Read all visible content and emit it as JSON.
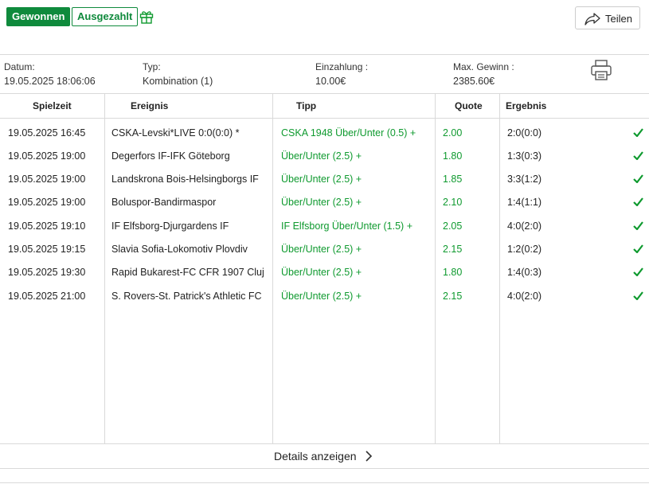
{
  "header": {
    "status_won": "Gewonnen",
    "status_paid": "Ausgezahlt",
    "share_label": "Teilen"
  },
  "info": {
    "date_label": "Datum:",
    "date_value": "19.05.2025 18:06:06",
    "type_label": "Typ:",
    "type_value": "Kombination (1)",
    "stake_label": "Einzahlung :",
    "stake_value": "10.00€",
    "maxwin_label": "Max. Gewinn :",
    "maxwin_value": "2385.60€"
  },
  "table": {
    "headers": {
      "time": "Spielzeit",
      "event": "Ereignis",
      "tip": "Tipp",
      "odds": "Quote",
      "result": "Ergebnis"
    },
    "rows": [
      {
        "time": "19.05.2025 16:45",
        "event": "CSKA-Levski*LIVE 0:0(0:0) *",
        "tip": "CSKA 1948 Über/Unter (0.5) +",
        "odds": "2.00",
        "result": "2:0(0:0)"
      },
      {
        "time": "19.05.2025 19:00",
        "event": "Degerfors IF-IFK Göteborg",
        "tip": "Über/Unter (2.5) +",
        "odds": "1.80",
        "result": "1:3(0:3)"
      },
      {
        "time": "19.05.2025 19:00",
        "event": "Landskrona Bois-Helsingborgs IF",
        "tip": "Über/Unter (2.5) +",
        "odds": "1.85",
        "result": "3:3(1:2)"
      },
      {
        "time": "19.05.2025 19:00",
        "event": "Boluspor-Bandirmaspor",
        "tip": "Über/Unter (2.5) +",
        "odds": "2.10",
        "result": "1:4(1:1)"
      },
      {
        "time": "19.05.2025 19:10",
        "event": "IF Elfsborg-Djurgardens IF",
        "tip": "IF Elfsborg Über/Unter (1.5) +",
        "odds": "2.05",
        "result": "4:0(2:0)"
      },
      {
        "time": "19.05.2025 19:15",
        "event": "Slavia Sofia-Lokomotiv Plovdiv",
        "tip": "Über/Unter (2.5) +",
        "odds": "2.15",
        "result": "1:2(0:2)"
      },
      {
        "time": "19.05.2025 19:30",
        "event": "Rapid Bukarest-FC CFR 1907 Cluj",
        "tip": "Über/Unter (2.5) +",
        "odds": "1.80",
        "result": "1:4(0:3)"
      },
      {
        "time": "19.05.2025 21:00",
        "event": "S. Rovers-St. Patrick's Athletic FC",
        "tip": "Über/Unter (2.5) +",
        "odds": "2.15",
        "result": "4:0(2:0)"
      }
    ]
  },
  "footer": {
    "details_label": "Details anzeigen"
  },
  "colors": {
    "accent": "#0f8a3c",
    "tip_green": "#0f9a2f",
    "border": "#d9d9d9"
  },
  "icons": {
    "gift": "gift-icon",
    "share": "share-arrow-icon",
    "print": "printer-icon",
    "check": "checkmark-icon",
    "chevron": "chevron-right-icon"
  }
}
